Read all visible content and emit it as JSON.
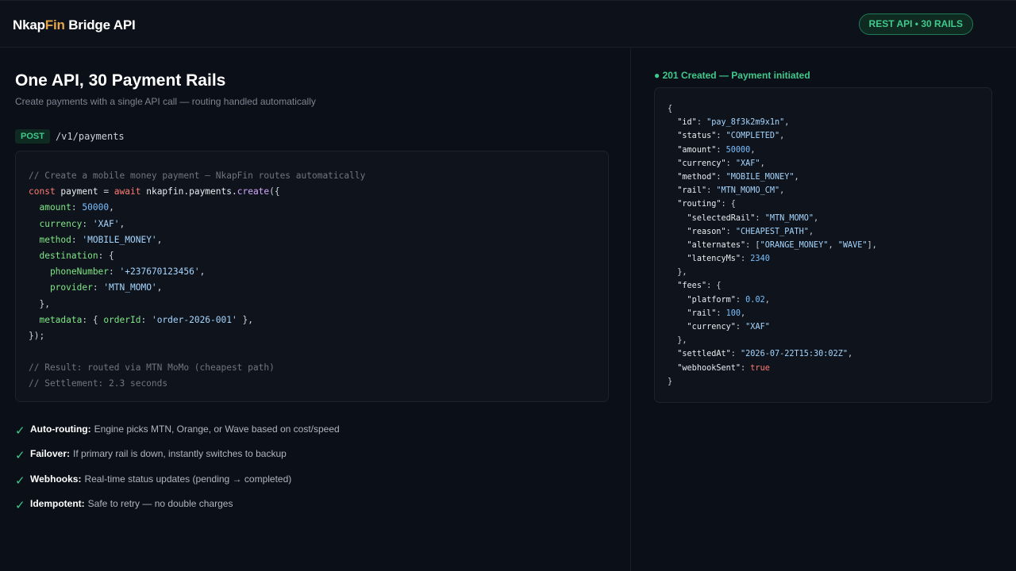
{
  "header": {
    "brand_prefix": "Nkap",
    "brand_accent": "Fin",
    "brand_suffix": " Bridge API",
    "badge": "REST API • 30 RAILS"
  },
  "main": {
    "title": "One API, 30 Payment Rails",
    "subtitle": "Create payments with a single API call — routing handled automatically",
    "endpoint": {
      "method": "POST",
      "path": "/v1/payments"
    },
    "code": {
      "comment1": "// Create a mobile money payment — NkapFin routes automatically",
      "l2_kw": "const",
      "l2_id": " payment ",
      "l2_eq": "= ",
      "l2_await": "await",
      "l2_obj": " nkapfin.payments.",
      "l2_fn": "create",
      "l2_end": "({",
      "amount_key": "  amount",
      "amount_val": "50000",
      "currency_key": "  currency",
      "currency_val": "'XAF'",
      "method_key": "  method",
      "method_val": "'MOBILE_MONEY'",
      "destination_key": "  destination",
      "destination_open": ": {",
      "phone_key": "    phoneNumber",
      "phone_val": "'+237670123456'",
      "provider_key": "    provider",
      "provider_val": "'MTN_MOMO'",
      "destination_close": "  },",
      "metadata_key": "  metadata",
      "metadata_open": ": { ",
      "orderid_key": "orderId",
      "orderid_val": "'order-2026-001'",
      "metadata_close": " },",
      "end": "});",
      "comment2": "// Result: routed via MTN MoMo (cheapest path)",
      "comment3": "// Settlement: 2.3 seconds"
    },
    "features": [
      {
        "label": "Auto-routing:",
        "text": "Engine picks MTN, Orange, or Wave based on cost/speed"
      },
      {
        "label": "Failover:",
        "text": "If primary rail is down, instantly switches to backup"
      },
      {
        "label": "Webhooks:",
        "text": "Real-time status updates (pending → completed)"
      },
      {
        "label": "Idempotent:",
        "text": "Safe to retry — no double charges"
      }
    ],
    "check_glyph": "✓"
  },
  "response": {
    "status": "● 201 Created — Payment initiated",
    "id": "\"pay_8f3k2m9x1n\"",
    "status_val": "\"COMPLETED\"",
    "amount": "50000",
    "currency": "\"XAF\"",
    "method": "\"MOBILE_MONEY\"",
    "rail": "\"MTN_MOMO_CM\"",
    "selectedRail": "\"MTN_MOMO\"",
    "reason": "\"CHEAPEST_PATH\"",
    "alt1": "\"ORANGE_MONEY\"",
    "alt2": "\"WAVE\"",
    "latencyMs": "2340",
    "platform": "0.02",
    "fee_rail": "100",
    "fee_currency": "\"XAF\"",
    "settledAt": "\"2026-07-22T15:30:02Z\"",
    "webhookSent": "true"
  },
  "colors": {
    "background": "#0b0f17",
    "accent_green": "#3fc98c",
    "brand_orange": "#e3a64a"
  }
}
